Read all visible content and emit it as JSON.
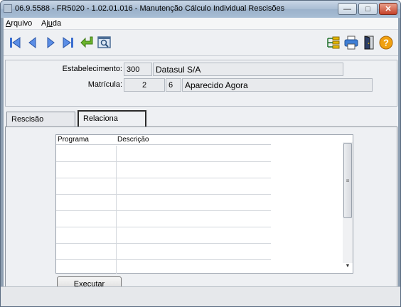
{
  "window": {
    "title": "06.9.5588 - FR5020 - 1.02.01.016 - Manutenção Cálculo Individual Rescisões",
    "minimize_glyph": "—",
    "maximize_glyph": "□",
    "close_glyph": "✕"
  },
  "menu": {
    "items": [
      {
        "label_pre": "",
        "label_ul": "A",
        "label_post": "rquivo"
      },
      {
        "label_pre": "Aj",
        "label_ul": "u",
        "label_post": "da"
      }
    ]
  },
  "toolbar": {
    "icons": [
      "first-record-icon",
      "previous-record-icon",
      "next-record-icon",
      "last-record-icon",
      "goto-record-icon",
      "search-icon",
      "hierarchy-icon",
      "print-icon",
      "exit-door-icon",
      "help-icon"
    ]
  },
  "header": {
    "estabelecimento_label": "Estabelecimento:",
    "estabelecimento_code": "300",
    "estabelecimento_name": "Datasul S/A",
    "matricula_label": "Matrícula:",
    "matricula_company": "2",
    "matricula_number": "6",
    "matricula_name": "Aparecido Agora"
  },
  "tabs": [
    {
      "label": "Rescisão",
      "active": false
    },
    {
      "label": "Relaciona",
      "active": true
    }
  ],
  "grid": {
    "columns": [
      "Programa",
      "Descrição"
    ],
    "rows": [
      [
        "",
        ""
      ],
      [
        "",
        ""
      ],
      [
        "",
        ""
      ],
      [
        "",
        ""
      ],
      [
        "",
        ""
      ],
      [
        "",
        ""
      ],
      [
        "",
        ""
      ],
      [
        "",
        ""
      ]
    ]
  },
  "actions": {
    "execute_label": "Executar"
  },
  "colors": {
    "nav_blue": "#3b6fd0",
    "goto_green": "#6cb52d",
    "help_orange": "#f0a010"
  }
}
